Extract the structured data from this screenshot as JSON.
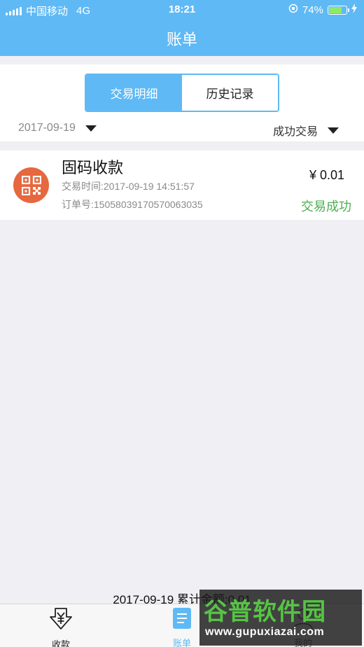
{
  "status_bar": {
    "carrier": "中国移动",
    "network": "4G",
    "time": "18:21",
    "battery": "74%",
    "battery_level": 0.74
  },
  "nav": {
    "title": "账单"
  },
  "filter": {
    "tabs": [
      {
        "label": "交易明细",
        "active": true
      },
      {
        "label": "历史记录",
        "active": false
      }
    ],
    "date": "2017-09-19",
    "status": "成功交易"
  },
  "transactions": [
    {
      "title": "固码收款",
      "time": "交易时间:2017-09-19 14:51:57",
      "order": "订单号:15058039170570063035",
      "amount": "¥ 0.01",
      "status": "交易成功",
      "icon": "qr-code-icon"
    }
  ],
  "summary": "2017-09-19 累计金额:0.01",
  "tabbar": {
    "items": [
      {
        "label": "收款",
        "icon": "yen-collect-icon"
      },
      {
        "label": "账单",
        "icon": "bill-list-icon"
      },
      {
        "label": "我的",
        "icon": "user-icon"
      }
    ]
  },
  "watermark": {
    "logo": "谷普软件园",
    "url": "www.gupuxiazai.com"
  },
  "colors": {
    "primary": "#5fb9f5",
    "success": "#4caf50",
    "icon_bg": "#e5683f"
  }
}
